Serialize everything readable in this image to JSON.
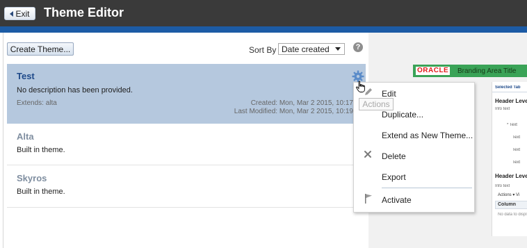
{
  "header": {
    "exit_label": "Exit",
    "title": "Theme Editor"
  },
  "toolbar": {
    "create_label": "Create Theme...",
    "sort_by_label": "Sort By",
    "sort_selected": "Date created",
    "help_glyph": "?"
  },
  "themes": [
    {
      "name": "Test",
      "description": "No description has been provided.",
      "extends": "Extends: alta",
      "created": "Created: Mon, Mar 2 2015, 10:17",
      "modified": "Last Modified: Mon, Mar 2 2015, 10:19"
    },
    {
      "name": "Alta",
      "description": "Built in theme."
    },
    {
      "name": "Skyros",
      "description": "Built in theme."
    }
  ],
  "tooltip": "Actions",
  "menu": {
    "items": [
      {
        "label": "Edit",
        "icon": "pencil-icon"
      },
      {
        "label": "Duplicate...",
        "icon": ""
      },
      {
        "label": "Extend as New Theme...",
        "icon": ""
      },
      {
        "label": "Delete",
        "icon": "x-icon"
      },
      {
        "label": "Export",
        "icon": ""
      },
      {
        "label": "Activate",
        "icon": "flag-icon"
      }
    ]
  },
  "preview": {
    "logo": "ORACLE",
    "branding_title": "Branding Area Title",
    "selected_tab": "Selected Tab",
    "header_level_1": "Header Leve",
    "info_text_1": "Info text",
    "field_labels": [
      "Text",
      "Text",
      "Text",
      "Text"
    ],
    "header_level_2": "Header Leve",
    "info_text_2": "Info text",
    "actions_label": "Actions",
    "view_label": "Vi",
    "column_header": "Column",
    "no_data": "No data to displ"
  },
  "colors": {
    "topbar": "#3a3a3a",
    "accent_blue": "#1c5ba5",
    "selected_row": "#b5c8de",
    "name_blue": "#1f4a8a",
    "name_gray": "#7f8ea0",
    "brand_green": "#3aa357"
  }
}
